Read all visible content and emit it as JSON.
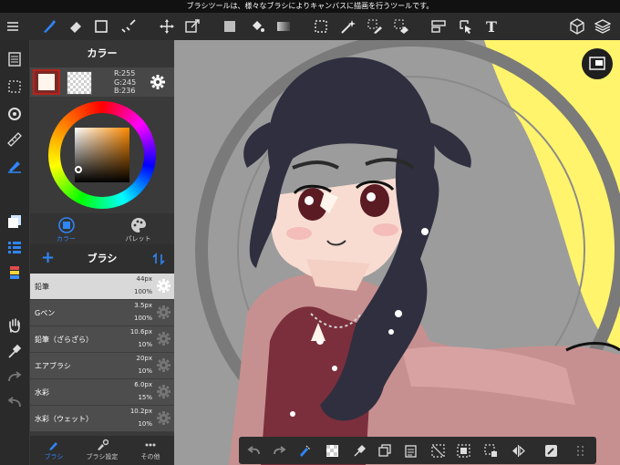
{
  "status_bar": {
    "text": "ブラシツールは、様々なブラシによりキャンバスに描画を行うツールです。"
  },
  "toolbar": {
    "icons": [
      "menu-icon",
      "brush-icon",
      "eraser-icon",
      "rectangle-icon",
      "select-brush-icon",
      "move-icon",
      "transform-icon",
      "fill-color-icon",
      "bucket-icon",
      "gradient-icon",
      "select-rect-icon",
      "magic-wand-icon",
      "select-pen-icon",
      "select-eraser-icon",
      "snap-icon",
      "operation-icon",
      "text-icon",
      "3d-icon",
      "layers-icon"
    ],
    "text_label": "T"
  },
  "color_panel": {
    "title": "カラー",
    "main_color": "#fff5ec",
    "rgb": {
      "r": "R:255",
      "g": "G:245",
      "b": "B:236"
    },
    "tabs": [
      {
        "label": "カラー",
        "active": true
      },
      {
        "label": "パレット",
        "active": false
      }
    ]
  },
  "brush_panel": {
    "title": "ブラシ",
    "add_label": "+",
    "brushes": [
      {
        "name": "鉛筆",
        "size": "44px",
        "opacity": "100%",
        "selected": true
      },
      {
        "name": "Gペン",
        "size": "3.5px",
        "opacity": "100%",
        "selected": false
      },
      {
        "name": "鉛筆（ざらざら）",
        "size": "10.6px",
        "opacity": "10%",
        "selected": false
      },
      {
        "name": "エアブラシ",
        "size": "20px",
        "opacity": "10%",
        "selected": false
      },
      {
        "name": "水彩",
        "size": "6.0px",
        "opacity": "15%",
        "selected": false
      },
      {
        "name": "水彩（ウェット）",
        "size": "10.2px",
        "opacity": "10%",
        "selected": false
      }
    ],
    "bottom_tabs": [
      {
        "label": "ブラシ",
        "active": true
      },
      {
        "label": "ブラシ設定",
        "active": false
      },
      {
        "label": "その他",
        "active": false
      }
    ]
  },
  "colors": {
    "accent": "#2f86f6",
    "selected_row": "#d9d9d9",
    "panel": "#3a3a3a",
    "canvas_yellow": "#fff46b"
  }
}
